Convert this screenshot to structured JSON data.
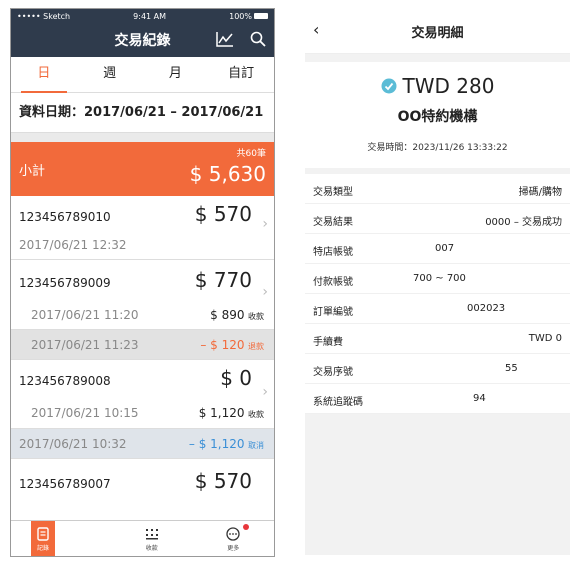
{
  "left": {
    "status": {
      "carrier": "••••• Sketch",
      "time": "9:41 AM",
      "battery": "100%"
    },
    "title": "交易紀錄",
    "tabs": [
      "日",
      "週",
      "月",
      "自訂"
    ],
    "date_range": "資料日期：2017/06/21 – 2017/06/21",
    "summary": {
      "label": "小計",
      "count": "共60筆",
      "total": "$ 5,630"
    },
    "records": [
      {
        "id": "123456789010",
        "amount": "$ 570",
        "time": "2017/06/21 12:32"
      },
      {
        "id": "123456789009",
        "amount": "$ 770",
        "time": "2017/06/21 11:20",
        "sub_value": "$ 890",
        "sub_tag": "收款"
      },
      {
        "id": "123456789008",
        "amount": "$ 0",
        "time": "2017/06/21 10:15",
        "sub_value": "$ 1,120",
        "sub_tag": "收款"
      },
      {
        "id": "123456789007",
        "amount": "$ 570"
      }
    ],
    "adjustments": [
      {
        "time": "2017/06/21 11:23",
        "value": "– $ 120",
        "tag": "退款"
      },
      {
        "time": "2017/06/21 10:32",
        "value": "– $ 1,120",
        "tag": "取消"
      }
    ],
    "bottom_nav": [
      "記錄",
      "收款",
      "更多"
    ]
  },
  "right": {
    "title": "交易明細",
    "back": "‹",
    "amount": "TWD 280",
    "merchant": "OO特約機構",
    "time": "交易時間：2023/11/26 13:33:22",
    "details": [
      {
        "key": "交易類型",
        "value": "掃碼/購物"
      },
      {
        "key": "交易結果",
        "value": "0000 – 交易成功"
      },
      {
        "key": "特店帳號",
        "value": "007"
      },
      {
        "key": "付款帳號",
        "value": "700 ~ 700"
      },
      {
        "key": "訂單編號",
        "value": "002023"
      },
      {
        "key": "手續費",
        "value": "TWD 0"
      },
      {
        "key": "交易序號",
        "value": "55"
      },
      {
        "key": "系統追蹤碼",
        "value": "94"
      }
    ]
  },
  "colors": {
    "accent": "#f26a3b",
    "header": "#2f3b4c",
    "refund": "#f26a3b",
    "cancel": "#3a8fd6",
    "check": "#5bbcd6"
  },
  "icons": [
    "chart-icon",
    "search-icon",
    "back-chevron-icon",
    "check-circle-icon",
    "record-icon",
    "grid-icon",
    "more-icon",
    "chevron-right-icon"
  ]
}
